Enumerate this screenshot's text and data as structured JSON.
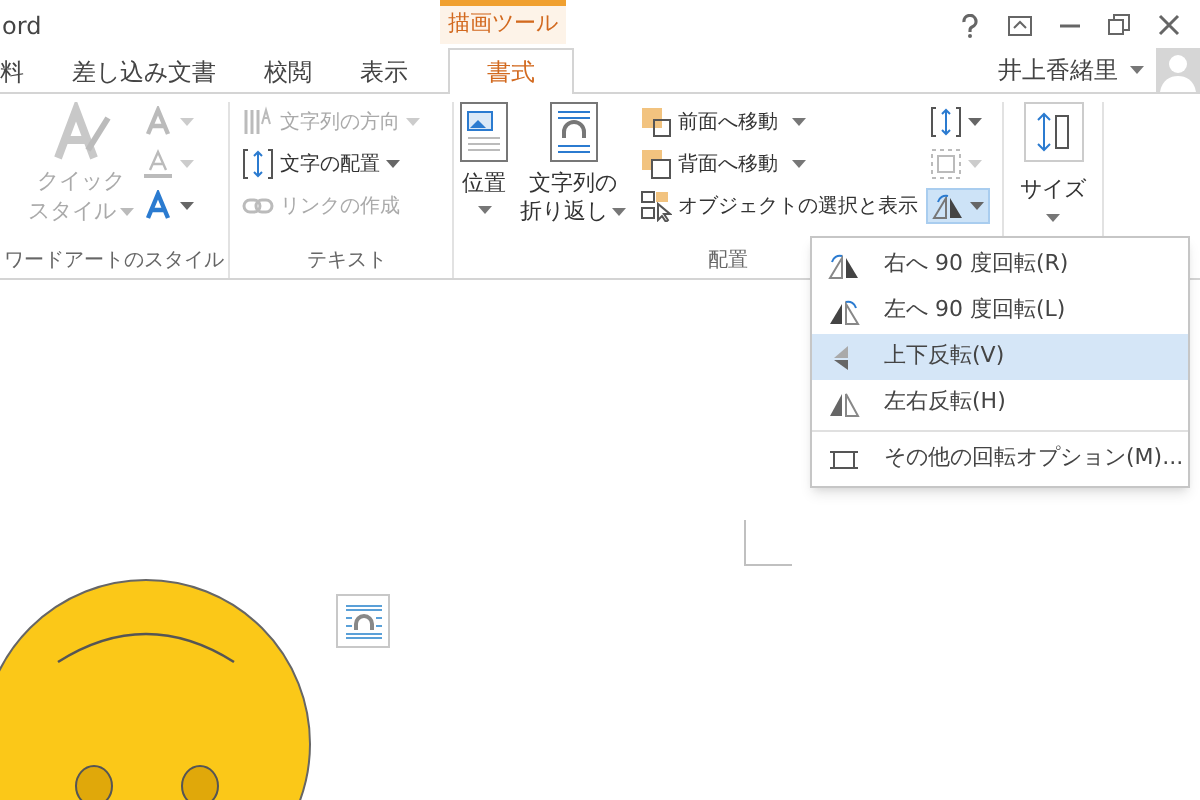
{
  "window": {
    "app_title": "ord",
    "context_tab": "描画ツール",
    "user": "井上香緒里"
  },
  "tabs": [
    {
      "label": "料",
      "selected": false
    },
    {
      "label": "差し込み文書",
      "selected": false
    },
    {
      "label": "校閲",
      "selected": false
    },
    {
      "label": "表示",
      "selected": false
    },
    {
      "label": "書式",
      "selected": true
    }
  ],
  "wordart_group": {
    "label": "ワードアートのスタイル",
    "quick_style": {
      "label_lines": [
        "クイック",
        "スタイル"
      ],
      "disabled": true
    },
    "buttons": [
      {
        "kind": "fill",
        "disabled": true
      },
      {
        "kind": "outline",
        "disabled": true
      },
      {
        "kind": "effects",
        "disabled": false
      }
    ]
  },
  "text_group": {
    "label": "テキスト",
    "items": [
      {
        "label": "文字列の方向",
        "kind": "direction",
        "dropdown": true,
        "disabled": true
      },
      {
        "label": "文字の配置",
        "kind": "align",
        "dropdown": true,
        "disabled": false
      },
      {
        "label": "リンクの作成",
        "kind": "link",
        "dropdown": false,
        "disabled": true
      }
    ]
  },
  "arrange_group": {
    "label": "配置",
    "big_buttons": [
      {
        "label_lines": [
          "位置"
        ],
        "kind": "position"
      },
      {
        "label_lines": [
          "文字列の",
          "折り返し"
        ],
        "kind": "wrap"
      }
    ],
    "small_buttons": [
      {
        "label": "前面へ移動",
        "kind": "forward",
        "dropdown": true
      },
      {
        "label": "背面へ移動",
        "kind": "backward",
        "dropdown": true
      },
      {
        "label": "オブジェクトの選択と表示",
        "kind": "selection",
        "dropdown": false
      }
    ],
    "icon_buttons": [
      {
        "kind": "align",
        "disabled": false,
        "pressed": false
      },
      {
        "kind": "group",
        "disabled": true,
        "pressed": false
      },
      {
        "kind": "rotate",
        "disabled": false,
        "pressed": true
      }
    ]
  },
  "size_group": {
    "label": "サイズ"
  },
  "rotate_menu": {
    "items": [
      {
        "label": "右へ 90 度回転(R)",
        "kind": "rotate-right",
        "selected": false
      },
      {
        "label": "左へ 90 度回転(L)",
        "kind": "rotate-left",
        "selected": false
      },
      {
        "label": "上下反転(V)",
        "kind": "flip-vertical",
        "selected": true
      },
      {
        "label": "左右反転(H)",
        "kind": "flip-horizontal",
        "selected": false
      },
      {
        "label": "その他の回転オプション(M)...",
        "kind": "more",
        "selected": false
      }
    ]
  }
}
